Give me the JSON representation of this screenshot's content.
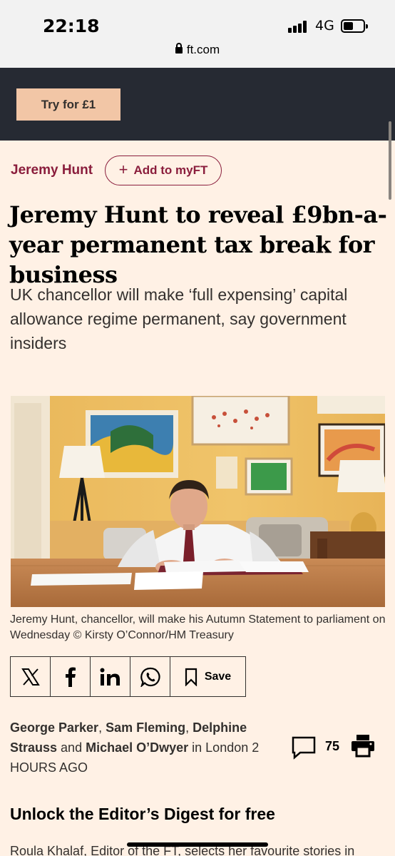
{
  "status": {
    "time": "22:18",
    "network": "4G",
    "url": "ft.com"
  },
  "promo": {
    "button": "Try for £1"
  },
  "article": {
    "topic": "Jeremy Hunt",
    "myft_label": "Add to myFT",
    "headline": "Jeremy Hunt to reveal £9bn-a-year permanent tax break for business",
    "standfirst": "UK chancellor will make ‘full expensing’ capital allowance regime permanent, say government insiders",
    "caption": "Jeremy Hunt, chancellor, will make his Autumn Statement to parliament on Wednesday © Kirsty O’Connor/HM Treasury"
  },
  "share": {
    "icons": [
      "x-icon",
      "facebook-icon",
      "linkedin-icon",
      "whatsapp-icon",
      "bookmark-icon"
    ],
    "save_label": "Save"
  },
  "byline": {
    "author1": "George Parker",
    "sep1": ", ",
    "author2": "Sam Fleming",
    "sep2": ", ",
    "author3": "Delphine Strauss",
    "sep3": " and ",
    "author4": "Michael O’Dwyer",
    "location": " in London ",
    "time": "2 HOURS AGO"
  },
  "comments": {
    "count": "75"
  },
  "digest": {
    "title": "Unlock the Editor’s Digest for free",
    "teaser": "Roula Khalaf, Editor of the FT, selects her favourite stories in"
  },
  "colors": {
    "claret": "#8a1d3c",
    "paper": "#fff1e5",
    "promo_bg": "#262a33",
    "promo_button": "#f2c6a6"
  }
}
